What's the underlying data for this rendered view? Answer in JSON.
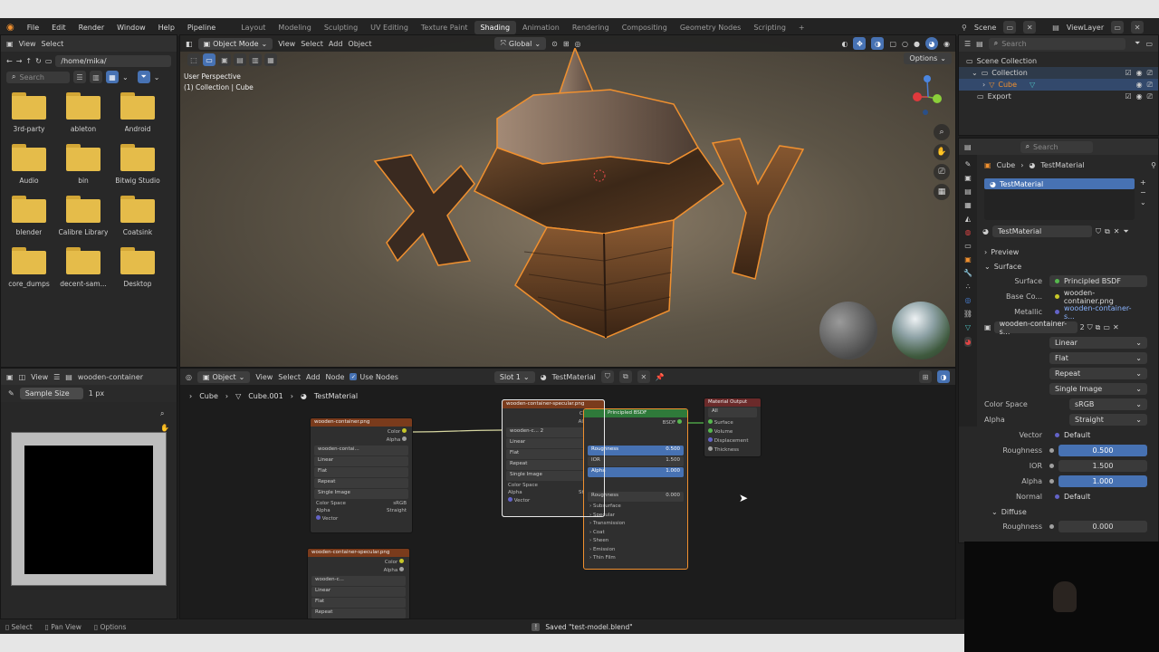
{
  "menu": [
    "File",
    "Edit",
    "Render",
    "Window",
    "Help",
    "Pipeline"
  ],
  "workspaces": [
    "Layout",
    "Modeling",
    "Sculpting",
    "UV Editing",
    "Texture Paint",
    "Shading",
    "Animation",
    "Rendering",
    "Compositing",
    "Geometry Nodes",
    "Scripting"
  ],
  "active_workspace": "Shading",
  "workspace_add": "+",
  "scene_label": "Scene",
  "viewlayer_label": "ViewLayer",
  "filebrowser": {
    "view": "View",
    "select": "Select",
    "path": "/home/mika/",
    "search_placeholder": "Search",
    "folders": [
      "3rd-party",
      "ableton",
      "Android",
      "Audio",
      "bin",
      "Bitwig Studio",
      "blender",
      "Calibre Library",
      "Coatsink",
      "core_dumps",
      "decent-sam...",
      "Desktop"
    ]
  },
  "viewport": {
    "mode": "Object Mode",
    "menus": [
      "View",
      "Select",
      "Add",
      "Object"
    ],
    "orientation": "Global",
    "options": "Options",
    "info_line1": "User Perspective",
    "info_line2": "(1) Collection | Cube"
  },
  "image_editor": {
    "view": "View",
    "image_name": "wooden-container",
    "sample_label": "Sample Size",
    "sample_value": "1 px"
  },
  "node_editor": {
    "type": "Object",
    "menus": [
      "View",
      "Select",
      "Add",
      "Node"
    ],
    "use_nodes": "Use Nodes",
    "slot": "Slot 1",
    "material": "TestMaterial",
    "breadcrumb": [
      "Cube",
      "Cube.001",
      "TestMaterial"
    ],
    "node1_title": "wooden-container.png",
    "node2_title": "wooden-container-specular.png",
    "node3_title": "wooden-container-specular.png",
    "bsdf_title": "Principled BSDF",
    "output_title": "Material Output",
    "output_target": "All",
    "output_inputs": [
      "Surface",
      "Volume",
      "Displacement",
      "Thickness"
    ],
    "bsdf_out": "BSDF",
    "tex_opts": [
      "Linear",
      "Flat",
      "Repeat",
      "Single Image"
    ],
    "color_space_label": "Color Space",
    "color_space": "sRGB",
    "alpha_label": "Alpha",
    "alpha_mode": "Straight",
    "vector": "Vector",
    "color_out": "Color",
    "alpha_out": "Alpha",
    "img_short": "wooden-c...",
    "img_med": "wooden-contai...",
    "bsdf_vals": [
      "0.500",
      "1.500",
      "1.000",
      "0.000"
    ],
    "bsdf_labels": [
      "Roughness",
      "IOR",
      "Alpha",
      "Roughness"
    ],
    "bsdf_sections": [
      "Subsurface",
      "Specular",
      "Transmission",
      "Coat",
      "Sheen",
      "Emission",
      "Thin Film"
    ],
    "users": "2"
  },
  "outliner": {
    "search_placeholder": "Search",
    "items": [
      "Scene Collection",
      "Collection",
      "Cube",
      "Export"
    ]
  },
  "properties": {
    "search_placeholder": "Search",
    "breadcrumb_obj": "Cube",
    "breadcrumb_mat": "TestMaterial",
    "slot": "TestMaterial",
    "material_name": "TestMaterial",
    "preview": "Preview",
    "surface_section": "Surface",
    "surface_label": "Surface",
    "surface_value": "Principled BSDF",
    "base_color_label": "Base Co...",
    "base_color_value": "wooden-container.png",
    "metallic_label": "Metallic",
    "metallic_value": "wooden-container-s...",
    "image_field": "wooden-container-s...",
    "image_users": "2",
    "interpolation": "Linear",
    "projection": "Flat",
    "extension": "Repeat",
    "source": "Single Image",
    "color_space_label": "Color Space",
    "color_space": "sRGB",
    "alpha_label": "Alpha",
    "alpha_mode": "Straight",
    "vector_label": "Vector",
    "vector_value": "Default",
    "roughness_label": "Roughness",
    "roughness_value": "0.500",
    "ior_label": "IOR",
    "ior_value": "1.500",
    "alpha_value_label": "Alpha",
    "alpha_value": "1.000",
    "normal_label": "Normal",
    "normal_value": "Default",
    "diffuse_section": "Diffuse",
    "diffuse_roughness_label": "Roughness",
    "diffuse_roughness_value": "0.000"
  },
  "statusbar": {
    "select": "Select",
    "pan": "Pan View",
    "options": "Options",
    "message": "Saved \"test-model.blend\""
  },
  "colors": {
    "accent_blue": "#4772b3",
    "selected_orange": "#f0902f",
    "folder_yellow": "#e5bc4a",
    "node_texture_header": "#7a3b1c",
    "node_bsdf_header": "#2f7a3a",
    "node_output_header": "#6b2a2a"
  }
}
